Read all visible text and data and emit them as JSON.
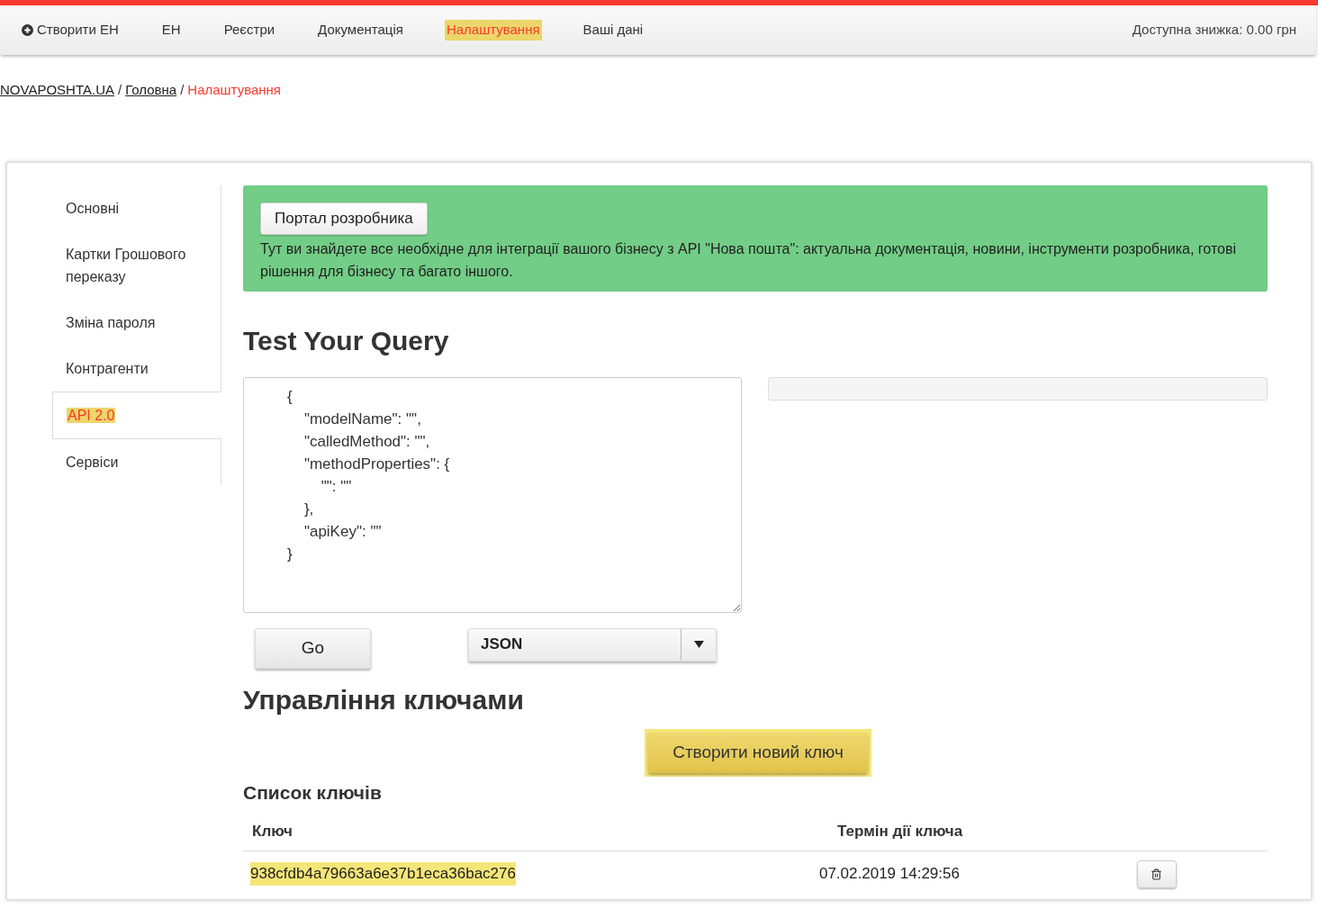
{
  "nav": {
    "items": [
      {
        "label": "Створити ЕН",
        "kind": "action",
        "selected": false
      },
      {
        "label": "ЕН",
        "kind": "link",
        "selected": false
      },
      {
        "label": "Реєстри",
        "kind": "link",
        "selected": false
      },
      {
        "label": "Документація",
        "kind": "link",
        "selected": false
      },
      {
        "label": "Налаштування",
        "kind": "link",
        "selected": true
      },
      {
        "label": "Ваші дані",
        "kind": "link",
        "selected": false
      }
    ],
    "discount": "Доступна знижка: 0.00 грн"
  },
  "breadcrumb": {
    "links": [
      "NOVAPOSHTA.UA",
      "Головна"
    ],
    "separators": [
      "/",
      "/"
    ],
    "current": "Налаштування"
  },
  "sidebar": {
    "items": [
      {
        "label": "Основні",
        "selected": false
      },
      {
        "label": "Картки Грошового переказу",
        "selected": false
      },
      {
        "label": "Зміна пароля",
        "selected": false
      },
      {
        "label": "Контрагенти",
        "selected": false
      },
      {
        "label": "API 2.0",
        "selected": true
      },
      {
        "label": "Сервіси",
        "selected": false
      }
    ]
  },
  "banner": {
    "button": "Портал розробника",
    "text": "Тут ви знайдете все необхідне для інтеграції вашого бізнесу з API \"Нова пошта\": актуальна документація, новини, інструменти розробника, готові рішення для бізнесу та багато іншого."
  },
  "query": {
    "title": "Test Your Query",
    "code": "{\n    \"modelName\": \"\",\n    \"calledMethod\": \"\",\n    \"methodProperties\": {\n        \"\": \"\"\n    },\n    \"apiKey\": \"\"\n}",
    "go_button": "Go",
    "format": "JSON"
  },
  "keys": {
    "title": "Управління ключами",
    "create_button": "Створити новий ключ",
    "list_title": "Список ключів",
    "columns": [
      "Ключ",
      "Термін дії ключа"
    ],
    "rows": [
      {
        "key": "938cfdb4a79663a6e37b1eca36bac276",
        "expires": "07.02.2019 14:29:56",
        "highlighted": true
      }
    ]
  }
}
